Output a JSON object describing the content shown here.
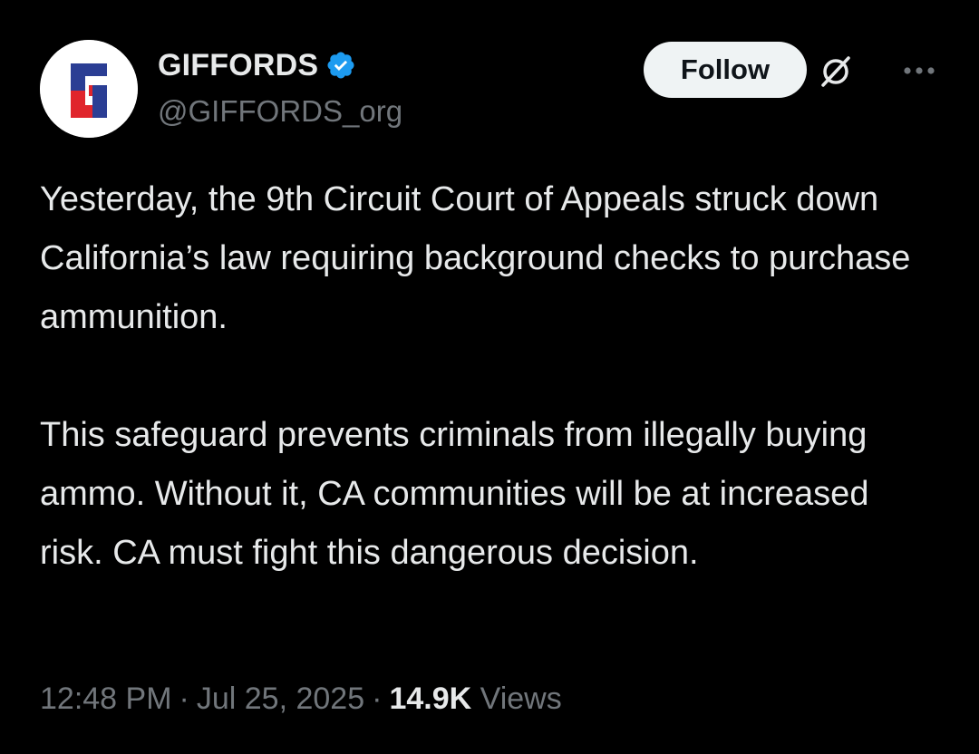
{
  "author": {
    "display_name": "GIFFORDS",
    "handle": "@GIFFORDS_org",
    "verified": true,
    "avatar_icon": "giffords-g-logo",
    "avatar_colors": {
      "blue": "#2b3e94",
      "red": "#e0252c",
      "background": "#ffffff"
    }
  },
  "actions": {
    "follow_label": "Follow",
    "grok_icon": "grok-icon",
    "more_icon": "more-icon"
  },
  "tweet": {
    "paragraphs": [
      "Yesterday, the 9th Circuit Court of Appeals struck down California’s law requiring background checks to purchase ammunition.",
      "This safeguard prevents criminals from illegally buying ammo. Without it, CA communities will be at increased risk. CA must fight this dangerous decision."
    ]
  },
  "meta": {
    "time": "12:48 PM",
    "date": "Jul 25, 2025",
    "views_count": "14.9K",
    "views_label": "Views"
  },
  "colors": {
    "background": "#000000",
    "text": "#e7e9ea",
    "secondary_text": "#71767b",
    "verified_badge": "#1d9bf0",
    "follow_button_bg": "#eff3f4"
  }
}
